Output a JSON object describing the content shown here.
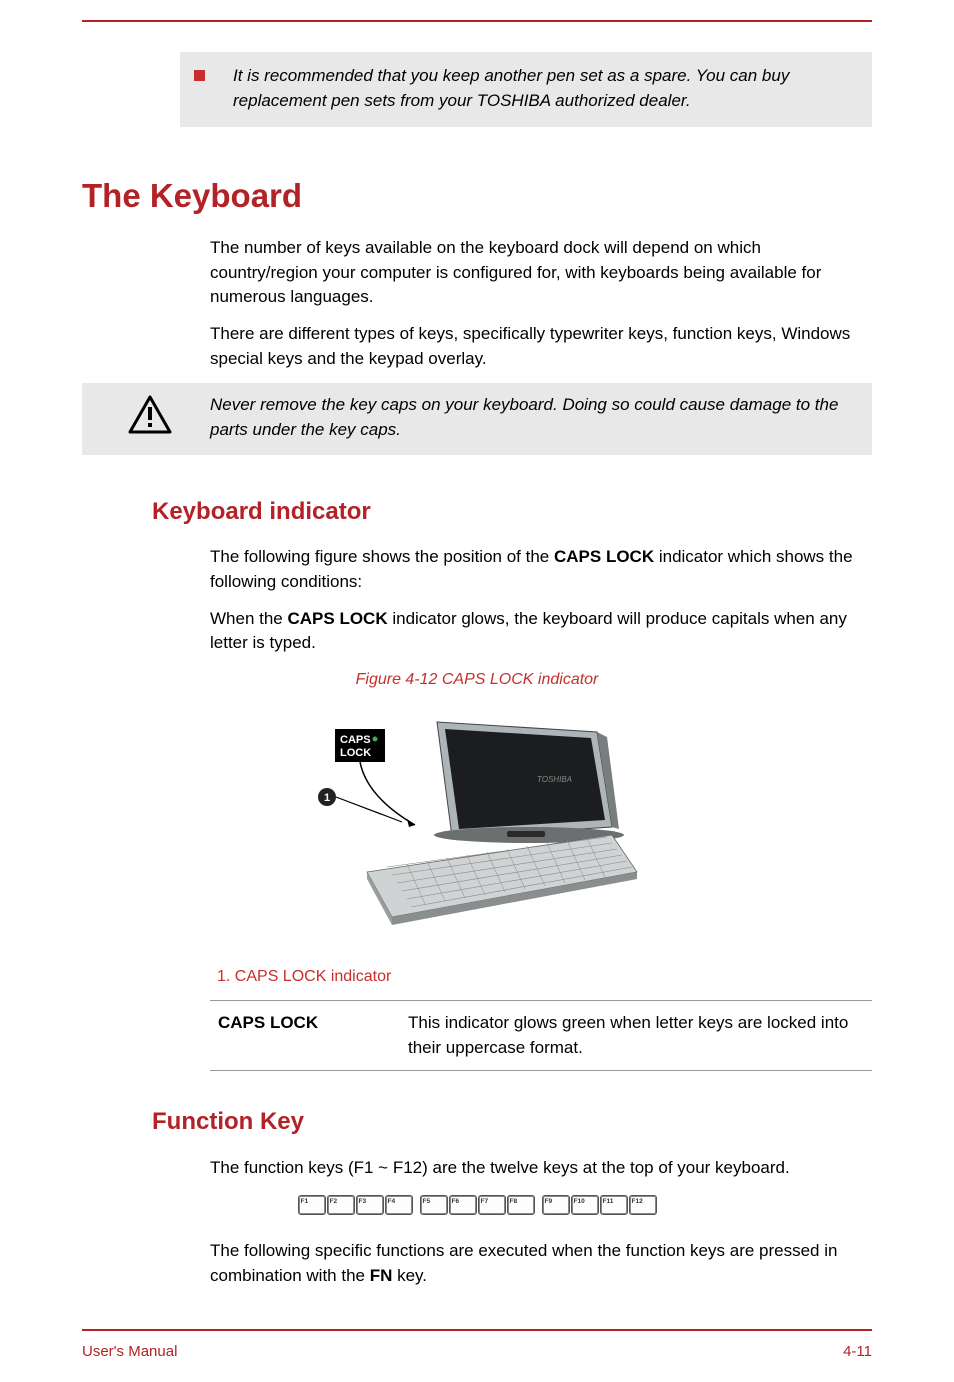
{
  "note": {
    "text": "It is recommended that you keep another pen set as a spare. You can buy replacement pen sets from your TOSHIBA authorized dealer."
  },
  "section_title": "The Keyboard",
  "para1": "The number of keys available on the keyboard dock will depend on which country/region your computer is configured for, with keyboards being available for numerous languages.",
  "para2": "There are different types of keys, specifically typewriter keys, function keys, Windows special keys and the keypad overlay.",
  "caution": "Never remove the key caps on your keyboard. Doing so could cause damage to the parts under the key caps.",
  "subsection1": "Keyboard indicator",
  "sub1_para1a": "The following figure shows the position of the ",
  "sub1_para1b": "CAPS LOCK",
  "sub1_para1c": " indicator which shows the following conditions:",
  "sub1_para2a": "When the ",
  "sub1_para2b": "CAPS LOCK",
  "sub1_para2c": " indicator glows, the keyboard will produce capitals when any letter is typed.",
  "figure_caption": "Figure 4-12 CAPS LOCK indicator",
  "figure_legend": "1. CAPS LOCK indicator",
  "callout_label": "CAPS\nLOCK",
  "table": {
    "label": "CAPS LOCK",
    "desc": "This indicator glows green when letter keys are locked into their uppercase format."
  },
  "subsection2": "Function Key",
  "sub2_para1": "The function keys (F1 ~ F12) are the twelve keys at the top of your keyboard.",
  "sub2_para2a": "The following specific functions are executed when the function keys are pressed in combination with the ",
  "sub2_para2b": "FN",
  "sub2_para2c": " key.",
  "fkeys": [
    "F1",
    "F2",
    "F3",
    "F4",
    "F5",
    "F6",
    "F7",
    "F8",
    "F9",
    "F10",
    "F11",
    "F12"
  ],
  "footer": {
    "left": "User's Manual",
    "right": "4-11"
  }
}
